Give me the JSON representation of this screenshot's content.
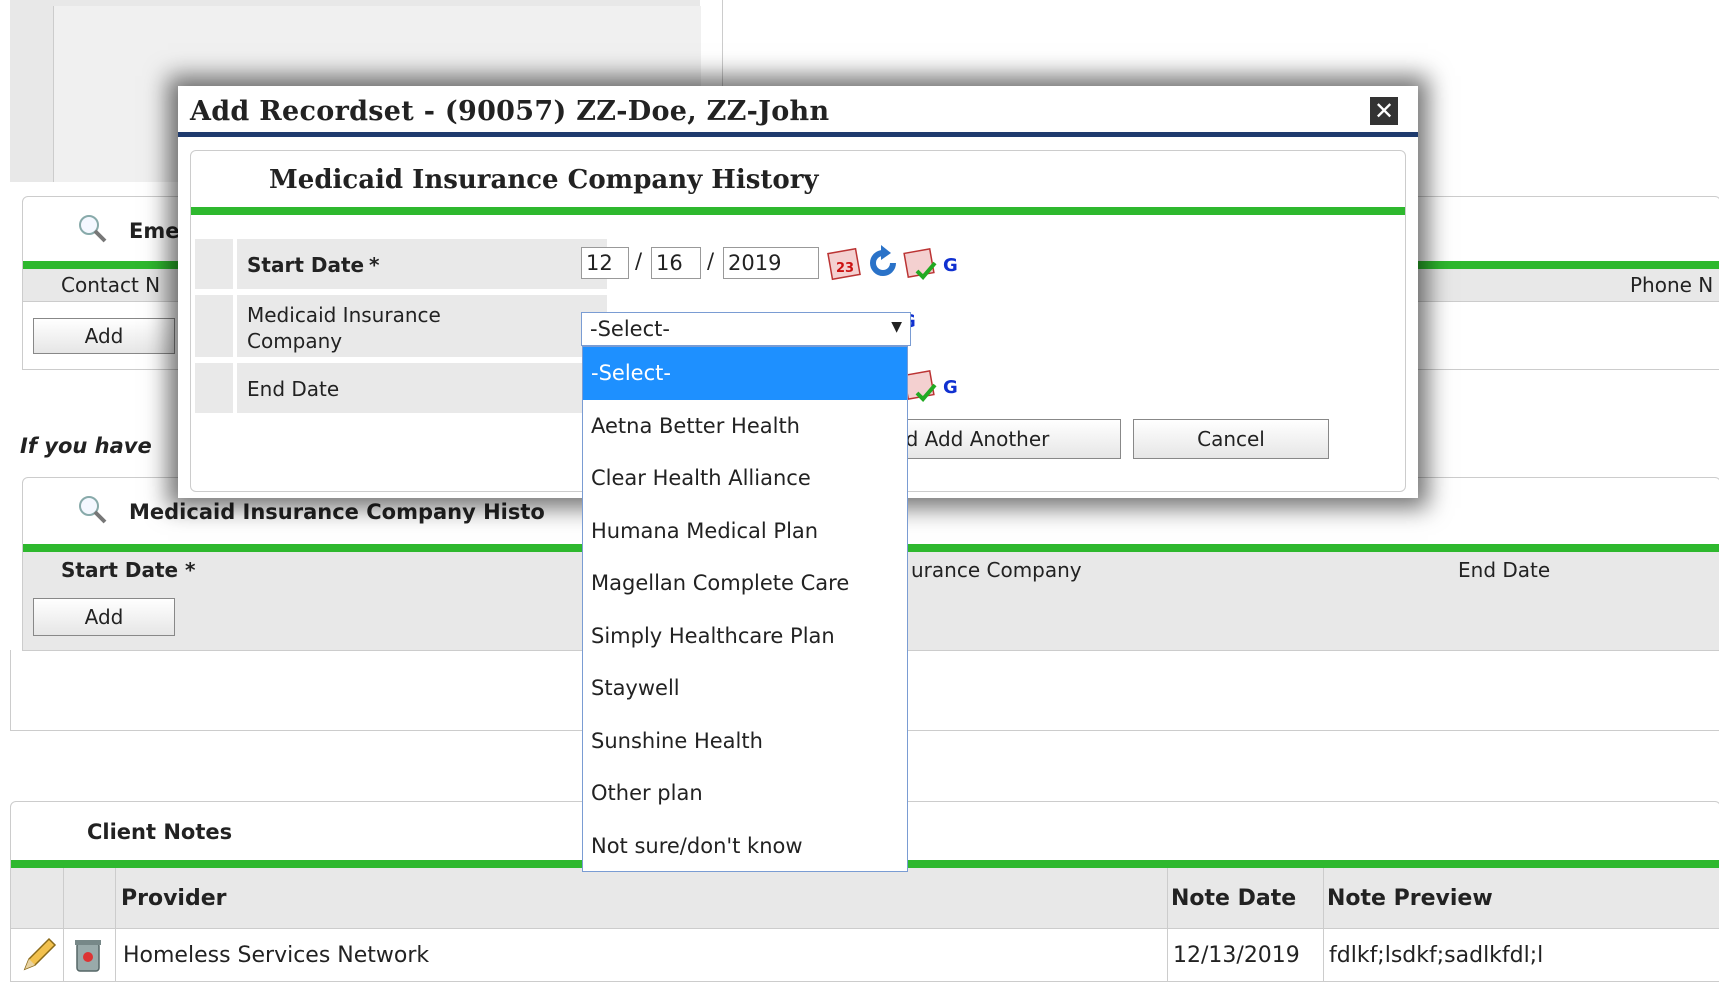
{
  "emergency_section": {
    "title_partial": "Eme",
    "col_contact": "Contact N",
    "col_phone": "Phone N",
    "add_label": "Add"
  },
  "note_partial": "If you have",
  "medicaid_section": {
    "title": "Medicaid Insurance Company Histo",
    "col_start": "Start Date *",
    "col_company_partial": "urance Company",
    "col_end": "End Date",
    "add_label": "Add"
  },
  "client_notes": {
    "title": "Client Notes",
    "headers": [
      "Provider",
      "Note Date",
      "Note Preview"
    ],
    "rows": [
      {
        "provider": "Homeless Services Network",
        "date": "12/13/2019",
        "preview": "fdlkf;lsdkf;sadlkfdl;l"
      }
    ]
  },
  "modal": {
    "title": "Add Recordset - (90057) ZZ-Doe, ZZ-John",
    "close_icon": "close-icon",
    "section_title": "Medicaid Insurance Company History",
    "start_label": "Start Date",
    "required_mark": "*",
    "start_month": "12",
    "start_day": "16",
    "start_year": "2019",
    "date_sep": "/",
    "company_label_1": "Medicaid Insurance",
    "company_label_2": "Company",
    "end_label": "End Date",
    "g_label": "G",
    "select_value": "-Select-",
    "save_another_partial": "e and Add Another",
    "cancel_label": "Cancel"
  },
  "dropdown": {
    "options": [
      "-Select-",
      "Aetna Better Health",
      "Clear Health Alliance",
      "Humana Medical Plan",
      "Magellan Complete Care",
      "Simply Healthcare Plan",
      "Staywell",
      "Sunshine Health",
      "Other plan",
      "Not sure/don't know"
    ],
    "selected_index": 0
  },
  "colors": {
    "green_bar": "#2eb82e",
    "modal_bar": "#1f3b6e",
    "selected_option": "#1e90ff",
    "g_link": "#1030d0"
  }
}
